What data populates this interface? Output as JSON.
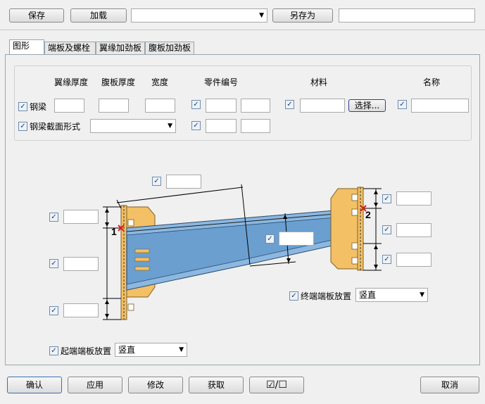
{
  "toolbar": {
    "save_label": "保存",
    "load_label": "加载",
    "preset_value": "",
    "save_as_label": "另存为",
    "save_as_name": ""
  },
  "tabs": [
    {
      "label": "图形",
      "active": true
    },
    {
      "label": "端板及螺栓",
      "active": false
    },
    {
      "label": "翼缘加劲板",
      "active": false
    },
    {
      "label": "腹板加劲板",
      "active": false
    }
  ],
  "properties": {
    "col_flange_thickness": "翼缘厚度",
    "col_web_thickness": "腹板厚度",
    "col_width": "宽度",
    "col_part_number": "零件编号",
    "col_material": "材料",
    "col_name": "名称",
    "row_beam_label": "钢梁",
    "row_section_label": "钢梁截面形式",
    "section_value": "",
    "select_button_label": "选择..."
  },
  "diagram": {
    "end_plate_mark_start": "1",
    "end_plate_mark_end": "2",
    "end_plate_placement_label": "终端端板放置",
    "end_plate_placement_value": "竖直",
    "start_plate_placement_label": "起端端板放置",
    "start_plate_placement_value": "竖直"
  },
  "footer": {
    "ok_label": "确认",
    "apply_label": "应用",
    "modify_label": "修改",
    "get_label": "获取",
    "toggle_label": "☑/☐",
    "cancel_label": "取消"
  },
  "colors": {
    "beam_fill": "#6a9fd0",
    "plate_fill": "#f3c065",
    "mark_red": "#e02020"
  }
}
